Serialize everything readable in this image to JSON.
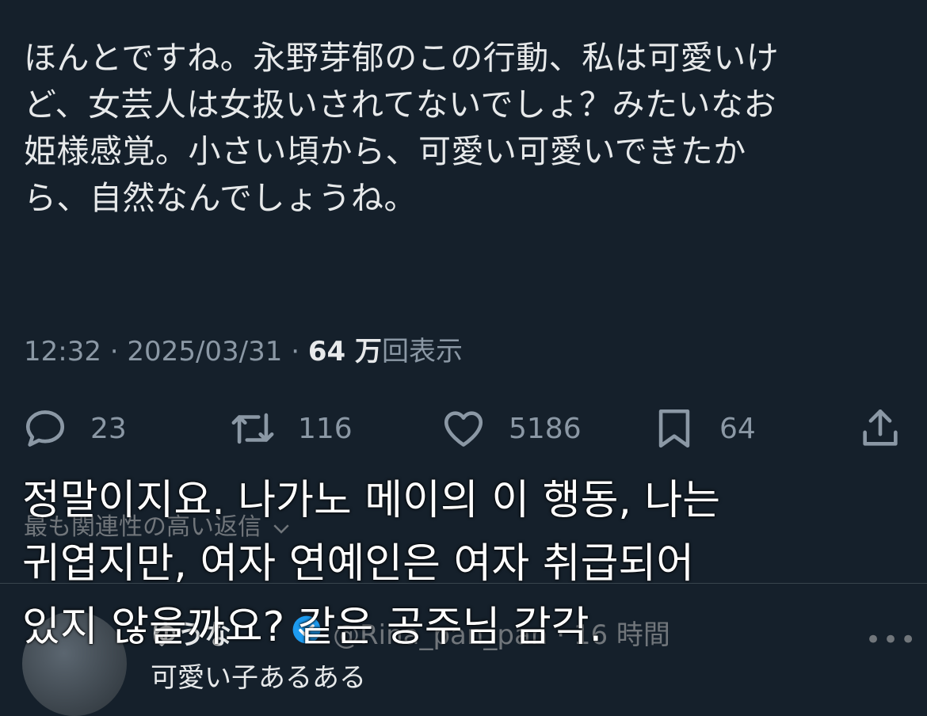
{
  "tweet": {
    "lines": [
      "ほんとですね。永野芽郁のこの行動、私は可愛いけ",
      "ど、女芸人は女扱いされてないでしょ？みたいなお",
      "姫様感覚。小さい頃から、可愛い可愛いできたか",
      "ら、自然なんでしょうね。"
    ],
    "time": "12:32",
    "date": "2025/03/31",
    "separator": "·",
    "views_count": "64 万",
    "views_label": "回表示"
  },
  "actions": {
    "reply_count": "23",
    "retweet_count": "116",
    "like_count": "5186",
    "bookmark_count": "64"
  },
  "replies": {
    "sort_label": "最も関連性の高い返信",
    "first": {
      "name": "ゆうな",
      "handle": "@Rina_pan_pan",
      "time": "16 時間",
      "text": "可愛い子あるある",
      "more": "•••"
    }
  },
  "translation_overlay": {
    "lines": [
      "정말이지요. 나가노 메이의 이 행동, 나는",
      "귀엽지만, 여자 연예인은 여자 취급되어",
      "있지 않을까요? 같은 공주님 감각."
    ]
  },
  "colors": {
    "background": "#15202b",
    "text": "#e7e9ea",
    "muted": "#8b98a5",
    "verified": "#1d9bf0"
  }
}
